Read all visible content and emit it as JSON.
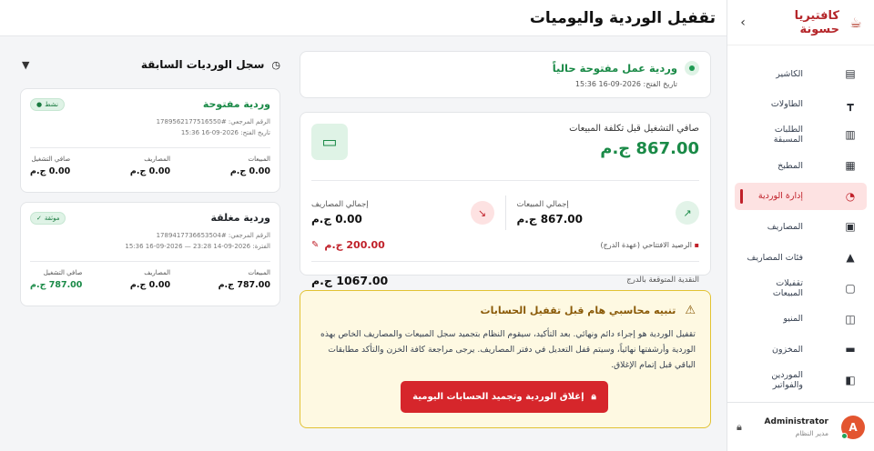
{
  "sidebar": {
    "brand": "كافتيريا حسونة",
    "items": [
      {
        "label": "الكاشير",
        "icon": "cash-register-icon"
      },
      {
        "label": "الطاولات",
        "icon": "table-icon"
      },
      {
        "label": "الطلبات المسبقة",
        "icon": "clipboard-icon"
      },
      {
        "label": "المطبخ",
        "icon": "kitchen-icon"
      },
      {
        "label": "إدارة الوردية",
        "icon": "clock-history-icon"
      },
      {
        "label": "المصاريف",
        "icon": "receipt-icon"
      },
      {
        "label": "فئات المصاريف",
        "icon": "shapes-icon"
      },
      {
        "label": "تقفيلات المبيعات",
        "icon": "document-icon"
      },
      {
        "label": "المنيو",
        "icon": "book-icon"
      },
      {
        "label": "المخزون",
        "icon": "archive-icon"
      },
      {
        "label": "الموردين والفواتير",
        "icon": "truck-icon"
      }
    ],
    "user": {
      "name": "Administrator",
      "role": "مدير النظام",
      "initial": "A"
    }
  },
  "header": {
    "title": "تقفيل الوردية واليوميات"
  },
  "open_shift": {
    "title": "وردية عمل مفتوحة حالياً",
    "opened": "تاريخ الفتح: 2026-09-16 15:36"
  },
  "net": {
    "label": "صافي التشغيل قبل تكلفة المبيعات",
    "value": "867.00 ج.م",
    "sales_label": "إجمالي المبيعات",
    "sales_value": "867.00 ج.م",
    "expenses_label": "إجمالي المصاريف",
    "expenses_value": "0.00 ج.م",
    "opening_label": "الرصيد الافتتاحي (عهدة الدرج)",
    "opening_value": "200.00 ج.م",
    "expected_label": "النقدية المتوقعة بالدرج",
    "expected_value": "1067.00 ج.م"
  },
  "warning": {
    "title": "تنبيه محاسبي هام قبل تقفيل الحسابات",
    "body": "تقفيل الوردية هو إجراء دائم ونهائي. بعد التأكيد، سيقوم النظام بتجميد سجل المبيعات والمصاريف الخاص بهذه الوردية وأرشفتها نهائياً، وسيتم قفل التعديل في دفتر المصاريف. يرجى مراجعة كافة الخزن والتأكد مطابقات الباقي قبل إتمام الإغلاق.",
    "button": "إغلاق الوردية وتجميد الحسابات اليومية"
  },
  "history": {
    "title": "سجل الورديات السابقة",
    "cards": [
      {
        "name": "وردية مفتوحة",
        "badge": "نشط",
        "ref": "الرقم المرجعي: #1789562177516550",
        "date": "تاريخ الفتح: 2026-09-16 15:36",
        "stats": [
          {
            "label": "المبيعات",
            "value": "0.00 ج.م"
          },
          {
            "label": "المصاريف",
            "value": "0.00 ج.م"
          },
          {
            "label": "صافي التشغيل",
            "value": "0.00 ج.م"
          }
        ]
      },
      {
        "name": "وردية مغلقة",
        "badge": "موثقة",
        "ref": "الرقم المرجعي: #1789417736653504",
        "date": "الفترة: 2026-09-14 23:28 — 2026-09-16 15:36",
        "stats": [
          {
            "label": "المبيعات",
            "value": "787.00 ج.م"
          },
          {
            "label": "المصاريف",
            "value": "0.00 ج.م"
          },
          {
            "label": "صافي التشغيل",
            "value": "787.00 ج.م"
          }
        ]
      }
    ]
  }
}
